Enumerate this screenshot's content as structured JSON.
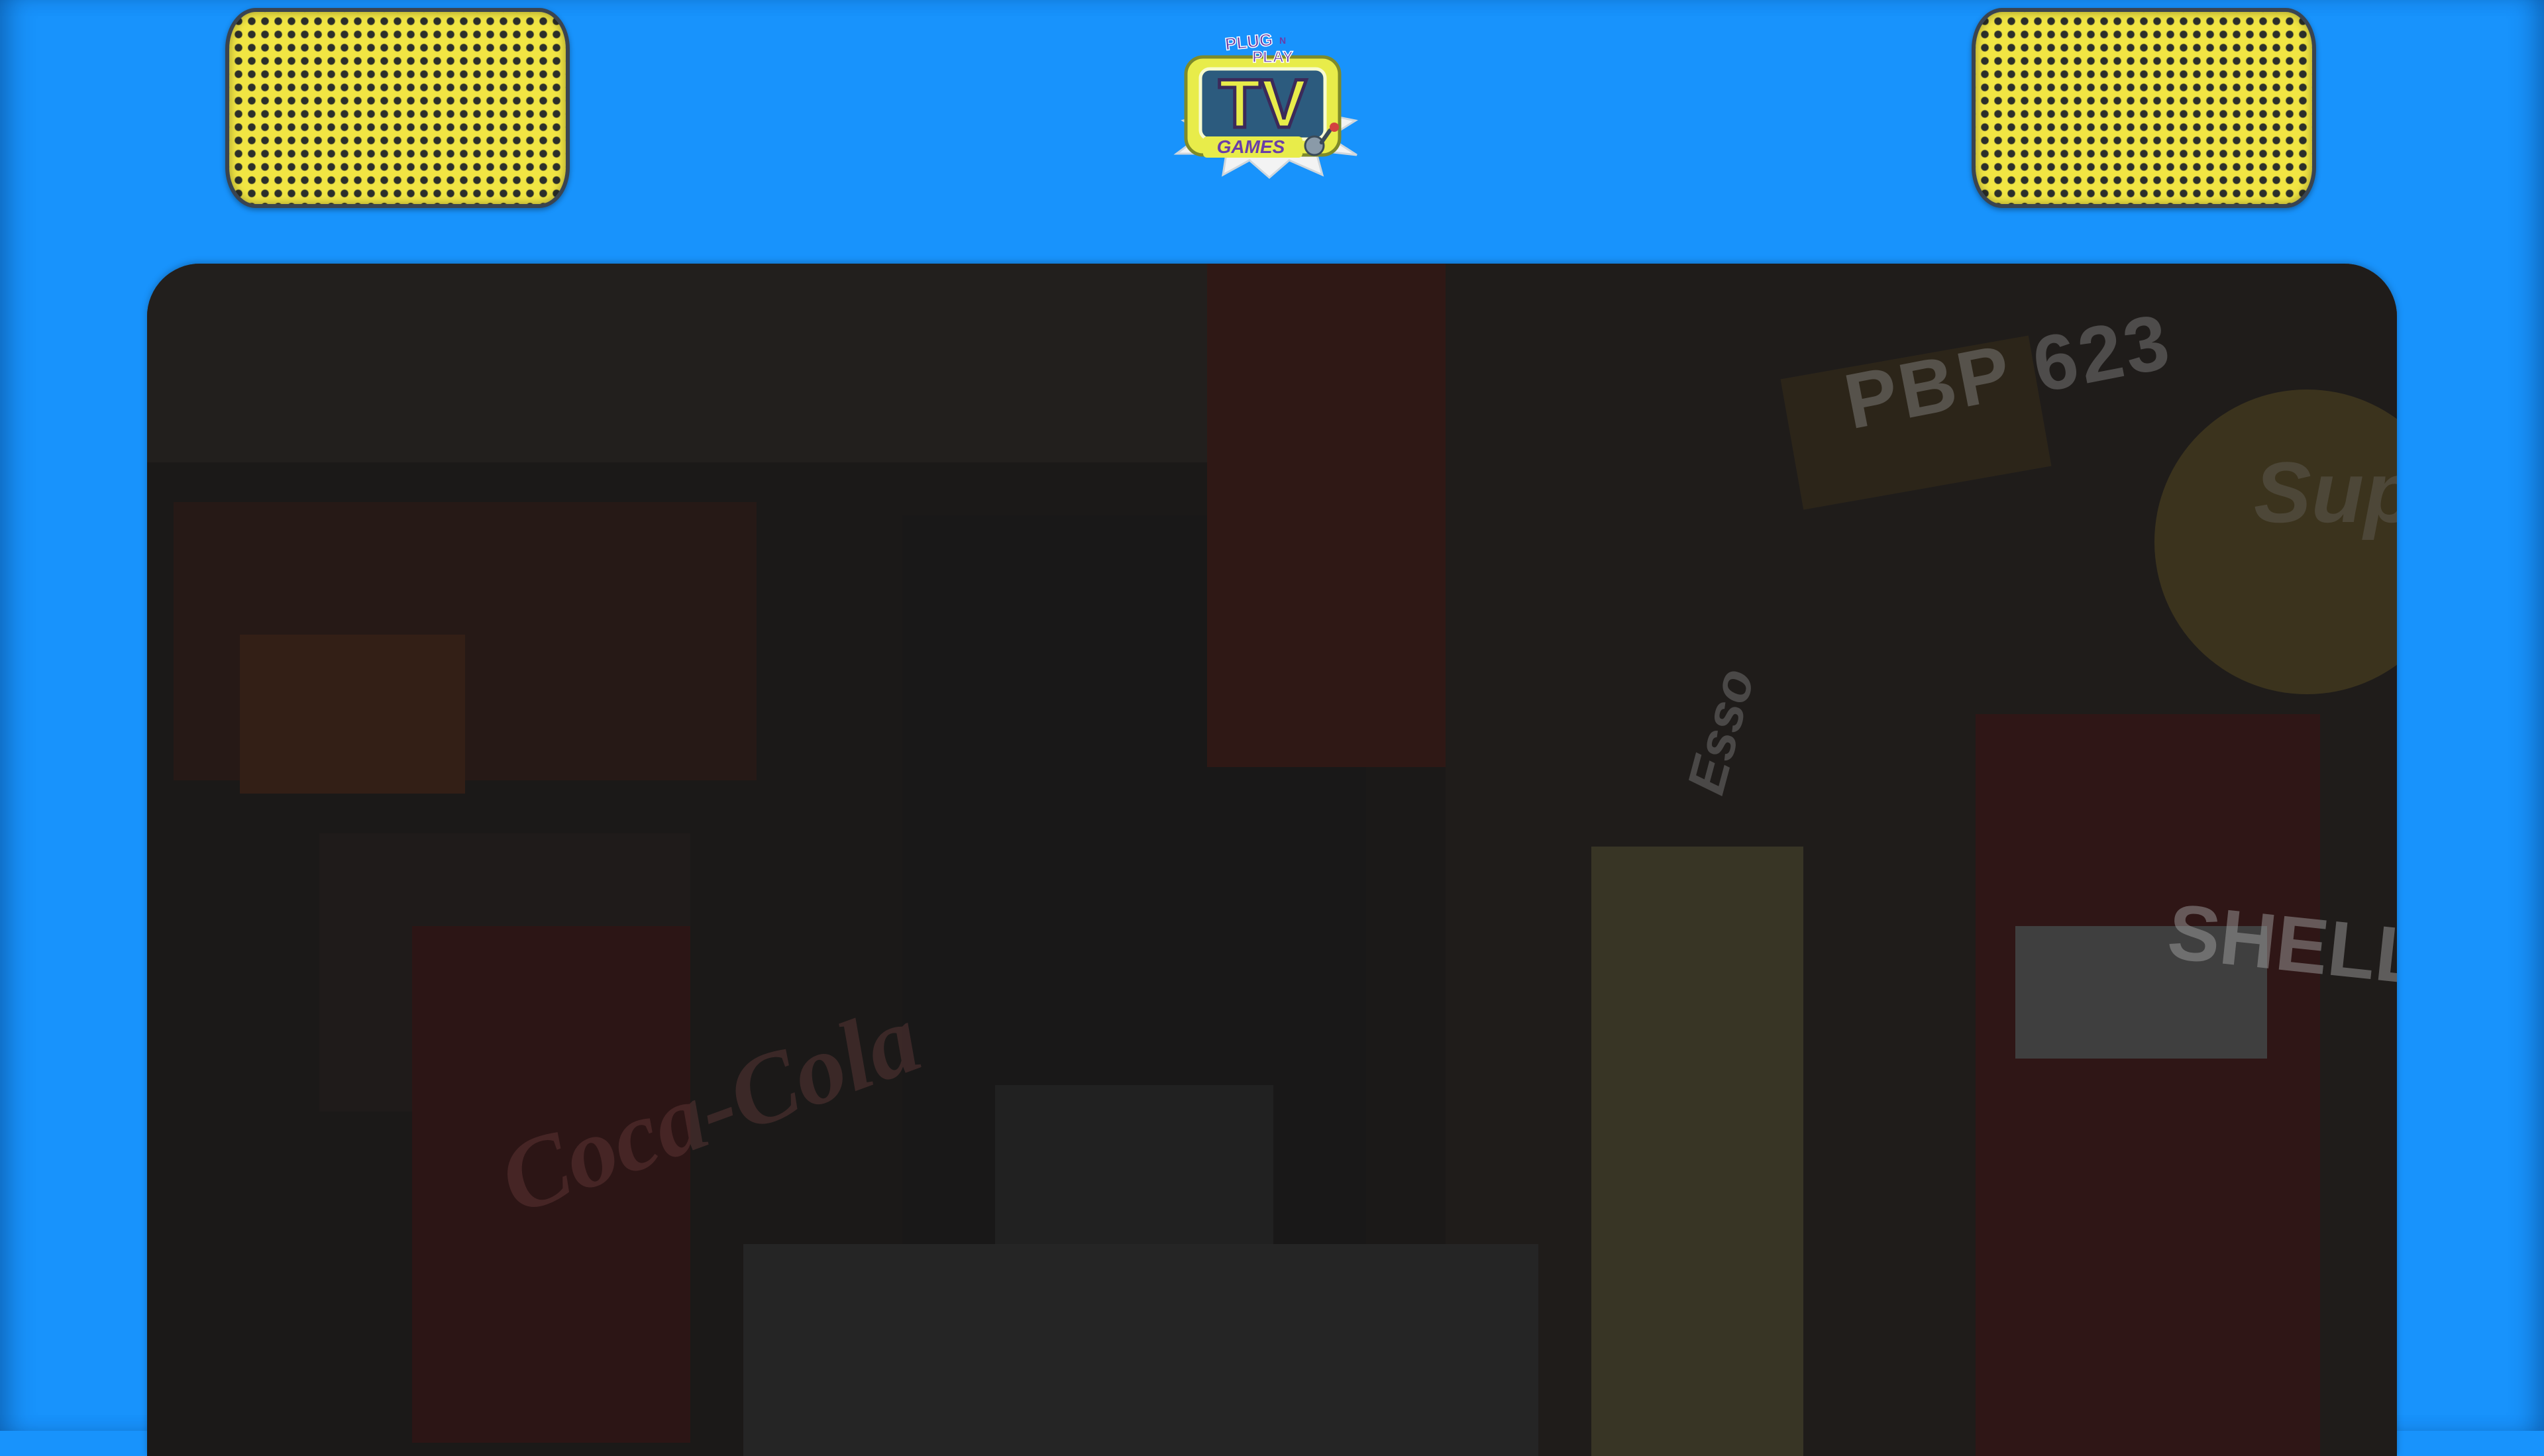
{
  "logo": {
    "line1": "PLUG",
    "line1_small": "N",
    "line2": "PLAY",
    "main": "TV",
    "line3": "GAMES"
  },
  "scene": {
    "license_plate": "PBP 623",
    "shell_sign": "SHELL",
    "coke_sign": "Coca-Cola",
    "esso_sign": "Esso",
    "super_sign": "Super SHELL"
  },
  "colors": {
    "background": "#1893fc",
    "speaker_grille": "#f1e543",
    "screen": "#1d1d1d",
    "logo_yellow": "#e8ec4a",
    "logo_purple": "#6a3ea8"
  },
  "icons": [
    "speaker-grille-icon",
    "speaker-grille-icon",
    "tv-logo-icon"
  ]
}
